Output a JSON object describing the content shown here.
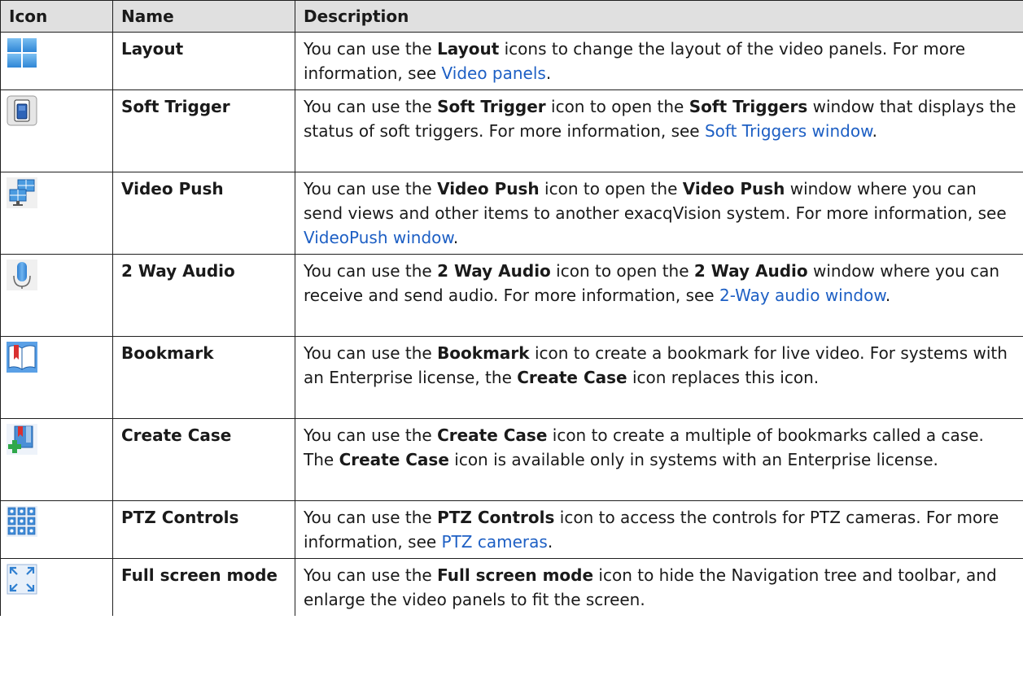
{
  "headers": {
    "icon": "Icon",
    "name": "Name",
    "description": "Description"
  },
  "colors": {
    "header_bg": "#e0e0e0",
    "border": "#1f1f1f",
    "link": "#1d5fc4",
    "icon_blue": "#4a9be0"
  },
  "rows": [
    {
      "icon": "layout-icon",
      "name": "Layout",
      "desc": {
        "t1": "You can use the ",
        "b1": "Layout",
        "t2": " icons to change the layout of the video panels. For more information, see ",
        "link": "Video panels",
        "t3": "."
      }
    },
    {
      "icon": "soft-trigger-icon",
      "name": "Soft Trigger",
      "desc": {
        "t1": "You can use the ",
        "b1": "Soft Trigger",
        "t2": " icon to open the ",
        "b2": "Soft Triggers",
        "t3": " window that displays the status of soft triggers. For more information, see ",
        "link": "Soft Triggers window",
        "t4": "."
      }
    },
    {
      "icon": "video-push-icon",
      "name": "Video Push",
      "desc": {
        "t1": "You can use the ",
        "b1": "Video Push",
        "t2": " icon to open the ",
        "b2": "Video Push",
        "t3": " window where you can send views and other items to another exacqVision system. For more information, see ",
        "link": "VideoPush window",
        "t4": "."
      }
    },
    {
      "icon": "microphone-icon",
      "name": "2 Way Audio",
      "desc": {
        "t1": "You can use the ",
        "b1": "2 Way Audio",
        "t2": " icon to open the ",
        "b2": "2 Way Audio",
        "t3": " window where you can receive and send audio. For more information, see ",
        "link": "2-Way audio window",
        "t4": "."
      }
    },
    {
      "icon": "bookmark-icon",
      "name": "Bookmark",
      "desc": {
        "t1": "You can use the ",
        "b1": "Bookmark",
        "t2": " icon to create a bookmark for live video. For systems with an Enterprise license, the ",
        "b2": "Create Case",
        "t3": " icon replaces this icon."
      }
    },
    {
      "icon": "create-case-icon",
      "name": "Create Case",
      "desc": {
        "t1": "You can use the ",
        "b1": "Create Case",
        "t2": " icon to create a multiple of bookmarks called a case. The ",
        "b2": "Create Case",
        "t3": " icon is available only in systems with an Enterprise license."
      }
    },
    {
      "icon": "ptz-controls-icon",
      "name": "PTZ Controls",
      "desc": {
        "t1": "You can use the ",
        "b1": "PTZ Controls",
        "t2": " icon to access the controls for PTZ cameras. For more information, see ",
        "link": "PTZ cameras",
        "t3": "."
      }
    },
    {
      "icon": "full-screen-icon",
      "name": "Full screen mode",
      "desc": {
        "t1": "You can use the ",
        "b1": "Full screen mode",
        "t2": " icon to hide the Navigation tree and toolbar, and enlarge the video panels to fit the screen."
      }
    }
  ]
}
